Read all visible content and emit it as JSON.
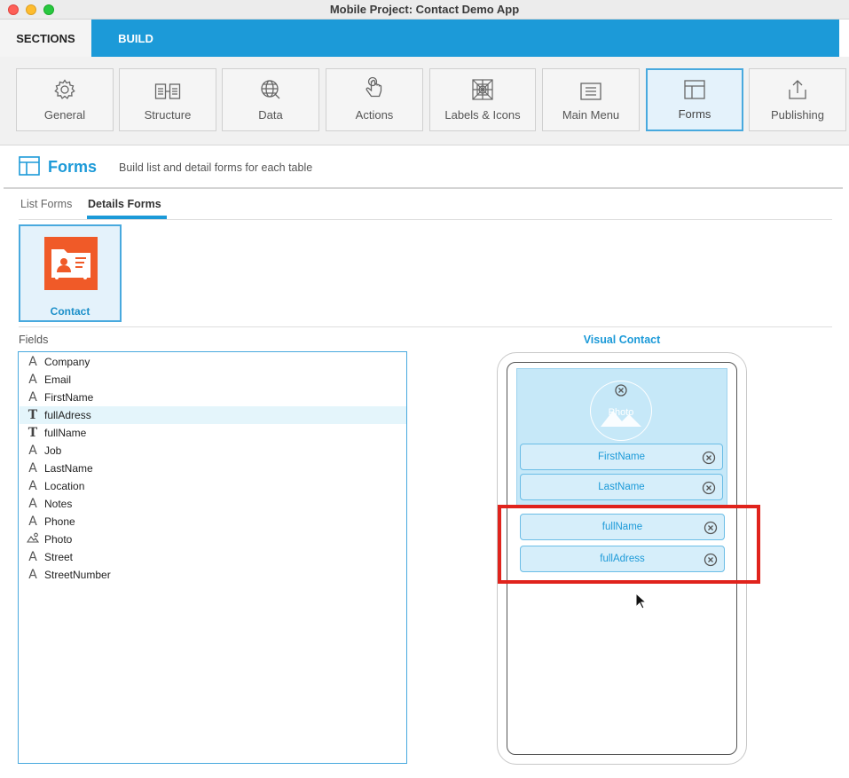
{
  "window": {
    "title": "Mobile Project: Contact Demo App"
  },
  "top_tabs": {
    "sections": "SECTIONS",
    "build": "BUILD"
  },
  "toolbar": {
    "items": [
      {
        "label": "General",
        "icon": "gear-icon"
      },
      {
        "label": "Structure",
        "icon": "structure-icon"
      },
      {
        "label": "Data",
        "icon": "data-globe-icon"
      },
      {
        "label": "Actions",
        "icon": "hand-pointer-icon"
      },
      {
        "label": "Labels & Icons",
        "icon": "labels-icons-icon"
      },
      {
        "label": "Main Menu",
        "icon": "menu-icon"
      },
      {
        "label": "Forms",
        "icon": "forms-icon",
        "active": true
      },
      {
        "label": "Publishing",
        "icon": "upload-icon"
      }
    ]
  },
  "section": {
    "title": "Forms",
    "subtitle": "Build list and detail forms for each table"
  },
  "subtabs": {
    "list": "List Forms",
    "details": "Details Forms"
  },
  "tables": [
    {
      "label": "Contact",
      "icon": "contact-card-icon"
    }
  ],
  "fields": {
    "label": "Fields",
    "items": [
      {
        "name": "Company",
        "type": "A"
      },
      {
        "name": "Email",
        "type": "A"
      },
      {
        "name": "FirstName",
        "type": "A"
      },
      {
        "name": "fullAdress",
        "type": "T",
        "selected": true
      },
      {
        "name": "fullName",
        "type": "T"
      },
      {
        "name": "Job",
        "type": "A"
      },
      {
        "name": "LastName",
        "type": "A"
      },
      {
        "name": "Location",
        "type": "A"
      },
      {
        "name": "Notes",
        "type": "A"
      },
      {
        "name": "Phone",
        "type": "A"
      },
      {
        "name": "Photo",
        "type": "image"
      },
      {
        "name": "Street",
        "type": "A"
      },
      {
        "name": "StreetNumber",
        "type": "A"
      }
    ]
  },
  "visual": {
    "title": "Visual Contact",
    "photo_label": "Photo",
    "header_fields": [
      "FirstName",
      "LastName"
    ],
    "body_fields": [
      "fullName",
      "fullAdress"
    ]
  },
  "colors": {
    "accent": "#1c9ad8",
    "highlight": "#e0231c",
    "contact_icon": "#f05a28"
  }
}
